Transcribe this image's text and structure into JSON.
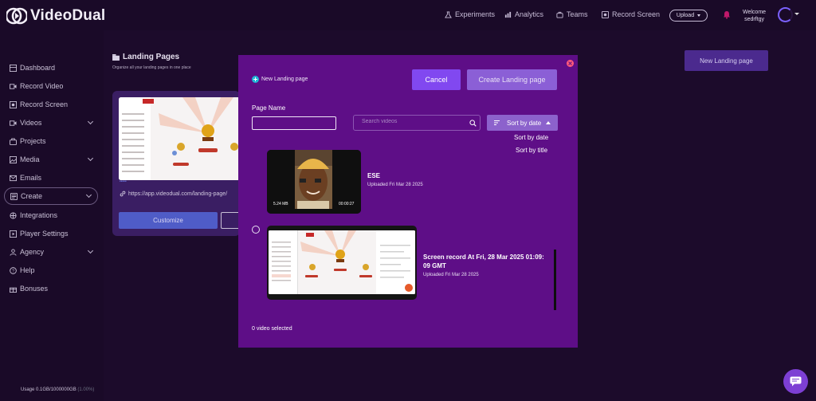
{
  "app": {
    "name": "VideoDual"
  },
  "topnav": {
    "items": [
      {
        "label": "Experiments",
        "icon": "experiments-icon"
      },
      {
        "label": "Analytics",
        "icon": "analytics-icon"
      },
      {
        "label": "Teams",
        "icon": "teams-icon"
      },
      {
        "label": "Record Screen",
        "icon": "record-screen-icon"
      }
    ],
    "upload_label": "Upload",
    "welcome_label": "Welcome",
    "username": "sedrftgy"
  },
  "sidebar": {
    "items": [
      {
        "label": "Dashboard",
        "icon": "dashboard-icon"
      },
      {
        "label": "Record Video",
        "icon": "record-video-icon"
      },
      {
        "label": "Record Screen",
        "icon": "record-screen-icon"
      },
      {
        "label": "Videos",
        "icon": "videos-icon"
      },
      {
        "label": "Projects",
        "icon": "projects-icon"
      },
      {
        "label": "Media",
        "icon": "media-icon"
      },
      {
        "label": "Emails",
        "icon": "emails-icon"
      },
      {
        "label": "Create",
        "icon": "create-icon"
      },
      {
        "label": "Integrations",
        "icon": "integrations-icon"
      },
      {
        "label": "Player Settings",
        "icon": "player-settings-icon"
      },
      {
        "label": "Agency",
        "icon": "agency-icon"
      },
      {
        "label": "Help",
        "icon": "help-icon"
      },
      {
        "label": "Bonuses",
        "icon": "bonuses-icon"
      }
    ],
    "usage_label": "Usage 0.1GB/1000000GB",
    "usage_percent": "(1.00%)"
  },
  "page": {
    "title": "Landing Pages",
    "subtitle": "Organize all your landing pages in one place",
    "new_button": "New Landing page",
    "card": {
      "dots": "•••••",
      "link": "https://app.videodual.com/landing-page/",
      "customize_label": "Customize"
    }
  },
  "modal": {
    "new_landing_link": "New Landing page",
    "cancel_label": "Cancel",
    "create_label": "Create Landing page",
    "page_name_label": "Page Name",
    "page_name_value": "",
    "search_placeholder": "Search videos",
    "sort": {
      "current": "Sort by date",
      "options": [
        "Sort by date",
        "Sort by title"
      ]
    },
    "videos": [
      {
        "title": "ESE",
        "uploaded": "Uploaded Fri Mar 28 2025",
        "size": "5.24 MB",
        "duration": "00:00:27"
      },
      {
        "title_line1": "Screen record At Fri, 28 Mar 2025 01:09:",
        "title_line2": "09 GMT",
        "uploaded": "Uploaded Fri Mar 28 2025"
      }
    ],
    "selected_count": "0 video selected"
  },
  "colors": {
    "modal_bg": "#5e0e87",
    "page_bg": "#1c0b2b",
    "accent": "#8148f0"
  }
}
